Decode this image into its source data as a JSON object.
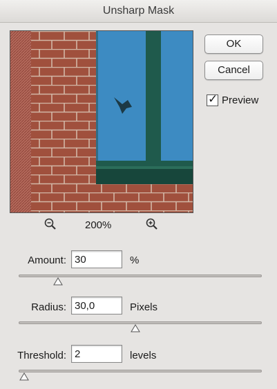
{
  "window": {
    "title": "Unsharp Mask"
  },
  "buttons": {
    "ok": "OK",
    "cancel": "Cancel"
  },
  "preview_checkbox": {
    "label": "Preview",
    "checked": true
  },
  "zoom": {
    "level": "200%",
    "zoom_out_icon": "zoom-out-icon",
    "zoom_in_icon": "zoom-in-icon"
  },
  "amount": {
    "label": "Amount:",
    "value": "30",
    "unit": "%",
    "slider_fraction": 0.15
  },
  "radius": {
    "label": "Radius:",
    "value": "30,0",
    "unit": "Pixels",
    "slider_fraction": 0.47
  },
  "threshold": {
    "label": "Threshold:",
    "value": "2",
    "unit": "levels",
    "slider_fraction": 0.01
  },
  "colors": {
    "brick": "#a0503d",
    "mortar": "#d3b7a6",
    "glass": "#3d8bc2",
    "window_frame": "#1f5a4c"
  }
}
